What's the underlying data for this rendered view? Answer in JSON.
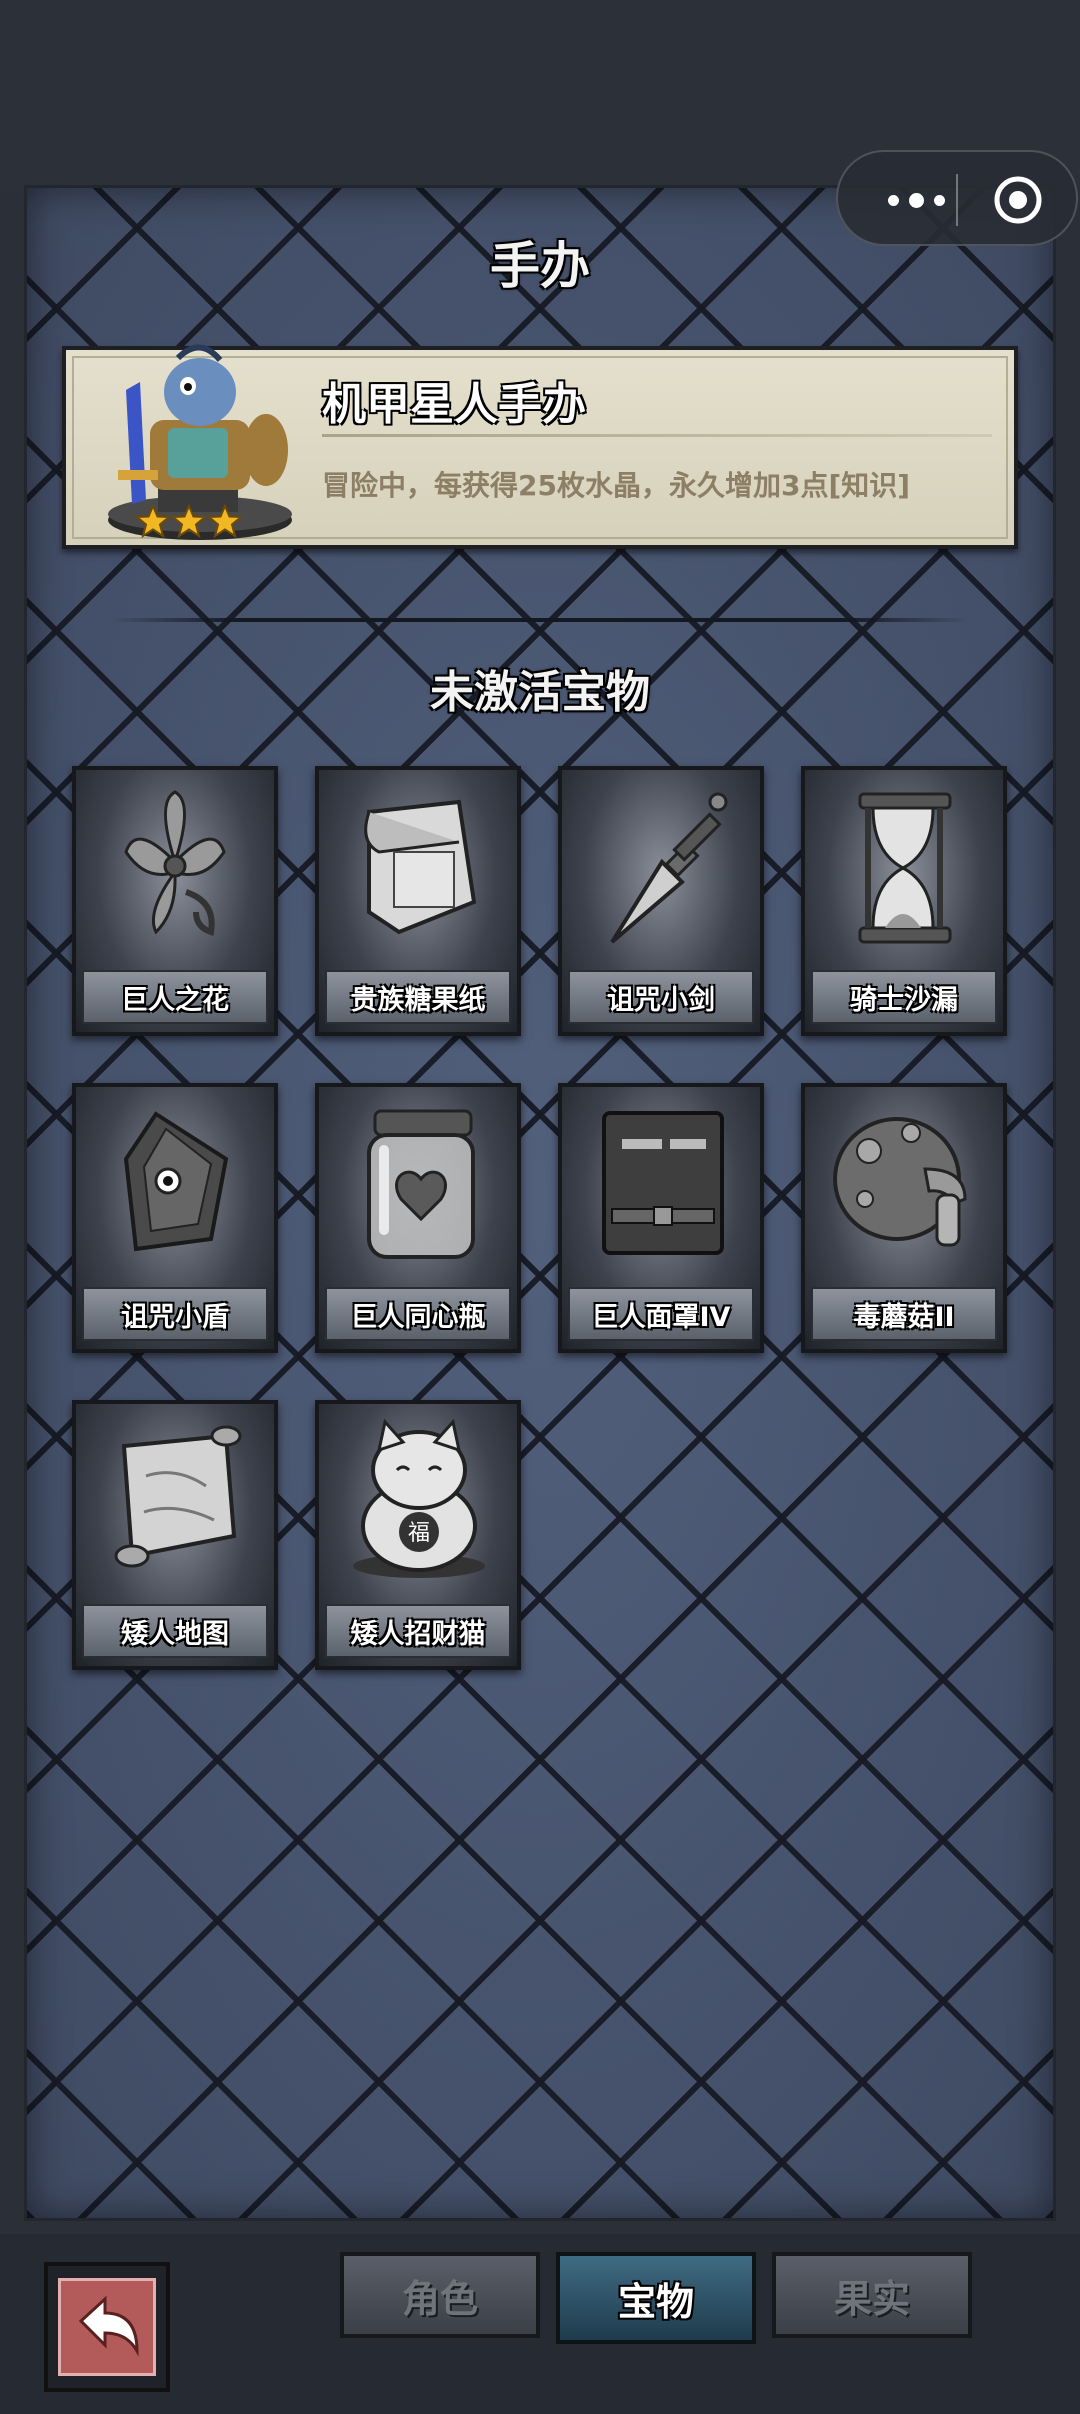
{
  "header": {
    "title": "手办"
  },
  "capsule": {
    "more_icon": "more-dots-icon",
    "close_icon": "target-circle-icon"
  },
  "figure": {
    "name": "机甲星人手办",
    "description": "冒险中，每获得25枚水晶，永久增加3点[知识]",
    "stars": 3,
    "star_color": "#f2b823"
  },
  "inactive_section": {
    "title": "未激活宝物"
  },
  "items": [
    {
      "name": "巨人之花",
      "icon": "flower-icon"
    },
    {
      "name": "贵族糖果纸",
      "icon": "wrapper-paper-icon"
    },
    {
      "name": "诅咒小剑",
      "icon": "dagger-icon"
    },
    {
      "name": "骑士沙漏",
      "icon": "hourglass-icon"
    },
    {
      "name": "诅咒小盾",
      "icon": "shield-icon"
    },
    {
      "name": "巨人同心瓶",
      "icon": "jar-heart-icon"
    },
    {
      "name": "巨人面罩IV",
      "icon": "mask-icon"
    },
    {
      "name": "毒蘑菇II",
      "icon": "mushroom-icon"
    },
    {
      "name": "矮人地图",
      "icon": "map-scroll-icon"
    },
    {
      "name": "矮人招财猫",
      "icon": "lucky-cat-icon"
    }
  ],
  "bottom_nav": {
    "back_icon": "back-arrow-icon",
    "tabs": [
      {
        "label": "角色",
        "active": false
      },
      {
        "label": "宝物",
        "active": true
      },
      {
        "label": "果实",
        "active": false
      }
    ]
  },
  "colors": {
    "panel": "#46516a",
    "card": "#e0dcc7",
    "desc_text": "#8d7f66",
    "active_tab": "#2f5468",
    "back_button": "#b35b5b"
  }
}
